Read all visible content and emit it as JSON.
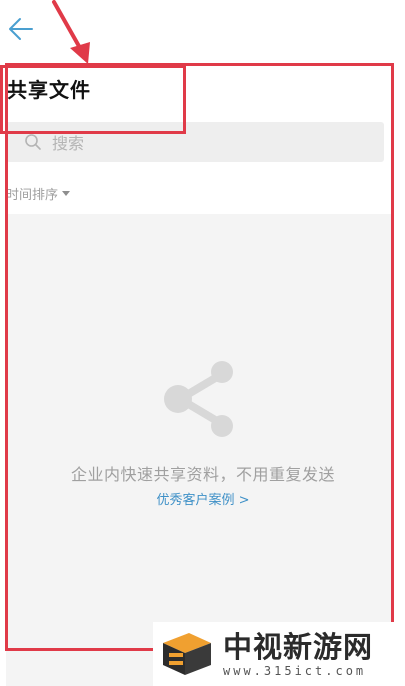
{
  "header": {
    "back_icon": "arrow-left-icon",
    "title": "共享文件"
  },
  "search": {
    "icon": "search-icon",
    "placeholder": "搜索"
  },
  "sort": {
    "label": "时间排序",
    "icon": "caret-down-icon"
  },
  "empty_state": {
    "icon": "share-icon",
    "message": "企业内快速共享资料，不用重复发送",
    "link_label": "优秀客户案例 >"
  },
  "annotation": {
    "color": "#e03a48"
  },
  "watermark": {
    "name": "中视新游网",
    "url": "www.315ict.com"
  },
  "colors": {
    "accent_link": "#3e90c7",
    "back_arrow": "#4a9fd0",
    "muted_text": "#a0a0a0"
  }
}
